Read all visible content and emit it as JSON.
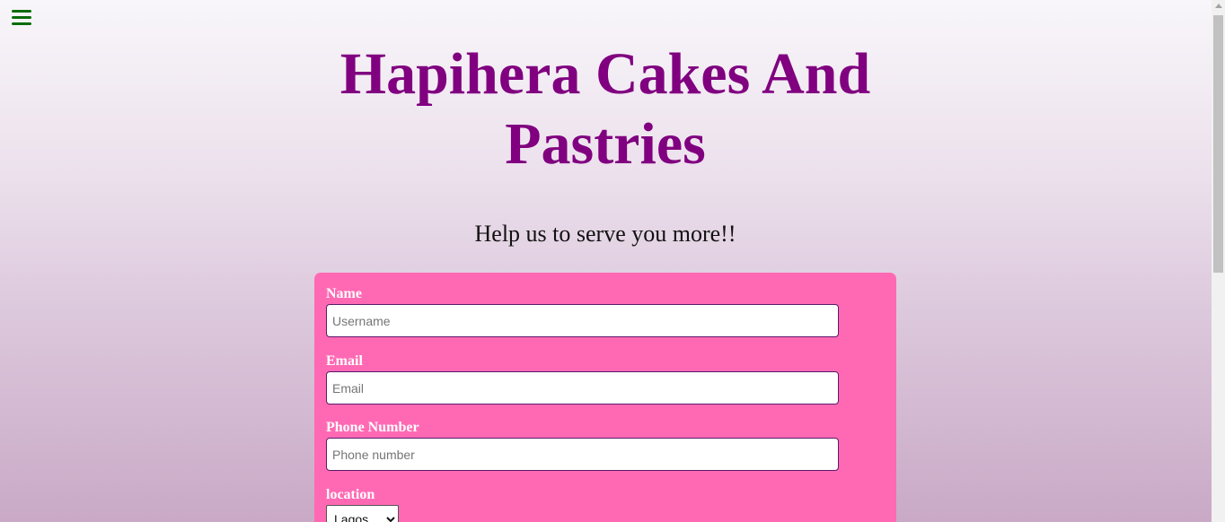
{
  "header": {
    "menu_icon": "hamburger-menu-icon",
    "title": "Hapihera Cakes And Pastries",
    "subtitle": "Help us to serve you more!!"
  },
  "form": {
    "name": {
      "label": "Name",
      "placeholder": "Username",
      "value": ""
    },
    "email": {
      "label": "Email",
      "placeholder": "Email",
      "value": ""
    },
    "phone": {
      "label": "Phone Number",
      "placeholder": "Phone number",
      "value": ""
    },
    "location": {
      "label": "location",
      "selected": "Lagos"
    }
  },
  "colors": {
    "title": "#800080",
    "form_background": "#ff69b4",
    "menu_icon": "#0a6b0a",
    "label_text": "#ffffff"
  }
}
